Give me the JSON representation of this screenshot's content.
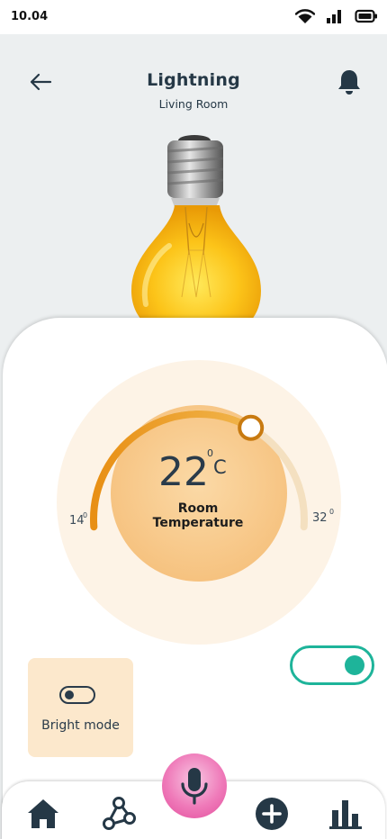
{
  "status_bar": {
    "time": "10.04",
    "icons": [
      "wifi-icon",
      "signal-icon",
      "battery-icon"
    ]
  },
  "header": {
    "title": "Lightning",
    "subtitle": "Living Room",
    "back_icon": "arrow-left-icon",
    "notification_icon": "bell-icon"
  },
  "thermostat": {
    "value": "22",
    "degree_symbol": "0",
    "unit": "C",
    "caption_line1": "Room",
    "caption_line2": "Temperature",
    "min_label": "14",
    "max_label": "32",
    "min_degree": "0",
    "max_degree": "0",
    "current_value": 22,
    "min_value": 14,
    "max_value": 32
  },
  "power_toggle": {
    "state": "on"
  },
  "bright_mode": {
    "label": "Bright mode",
    "icon": "toggle-off-icon"
  },
  "bottom_nav": {
    "items": [
      "home-icon",
      "share-nodes-icon",
      "microphone-icon",
      "plus-circle-icon",
      "bar-chart-icon"
    ],
    "active": "home-icon"
  },
  "colors": {
    "accent_orange": "#eb9b2c",
    "dial_core": "#f8cf92",
    "toggle_green": "#1eb49a",
    "bright_card": "#fce8cc",
    "mic_pink": "#ef7ab9",
    "text_dark": "#253846"
  }
}
